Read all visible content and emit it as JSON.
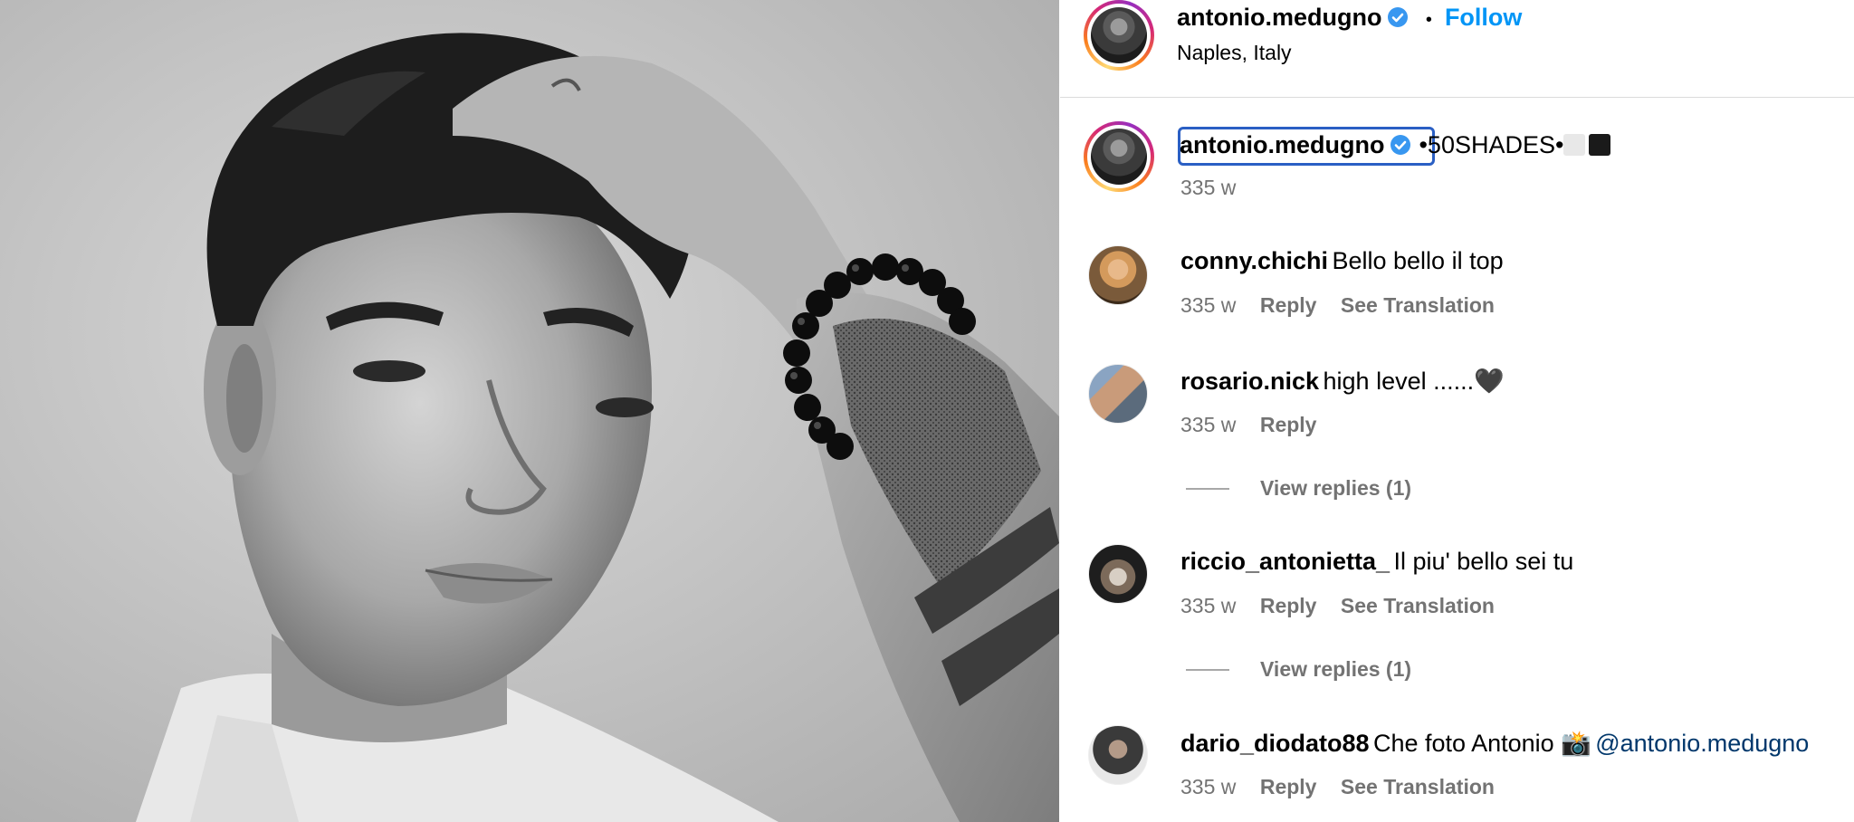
{
  "header": {
    "username": "antonio.medugno",
    "separator": "•",
    "follow_label": "Follow",
    "location": "Naples, Italy"
  },
  "caption": {
    "username": "antonio.medugno",
    "text_prefix": "•50SHADES•",
    "time": "335 w"
  },
  "comments": [
    {
      "username": "conny.chichi",
      "text": "Bello bello il top",
      "time": "335 w",
      "reply_label": "Reply",
      "translate_label": "See Translation"
    },
    {
      "username": "rosario.nick",
      "text": "high level ......🖤",
      "time": "335 w",
      "reply_label": "Reply",
      "view_replies": "View replies (1)"
    },
    {
      "username": "riccio_antonietta_",
      "text": "Il piu' bello sei tu",
      "time": "335 w",
      "reply_label": "Reply",
      "translate_label": "See Translation",
      "view_replies": "View replies (1)"
    },
    {
      "username": "dario_diodato88",
      "text": "Che foto Antonio 📸",
      "mention": "@antonio.medugno",
      "time": "335 w",
      "reply_label": "Reply",
      "translate_label": "See Translation"
    }
  ],
  "icons": {
    "verified": "verified-badge-icon",
    "square_white": "white-square",
    "square_black": "black-square"
  },
  "colors": {
    "follow": "#0095f6",
    "meta": "#737373",
    "mention": "#00376b",
    "focus_outline": "#2a5fc4"
  }
}
